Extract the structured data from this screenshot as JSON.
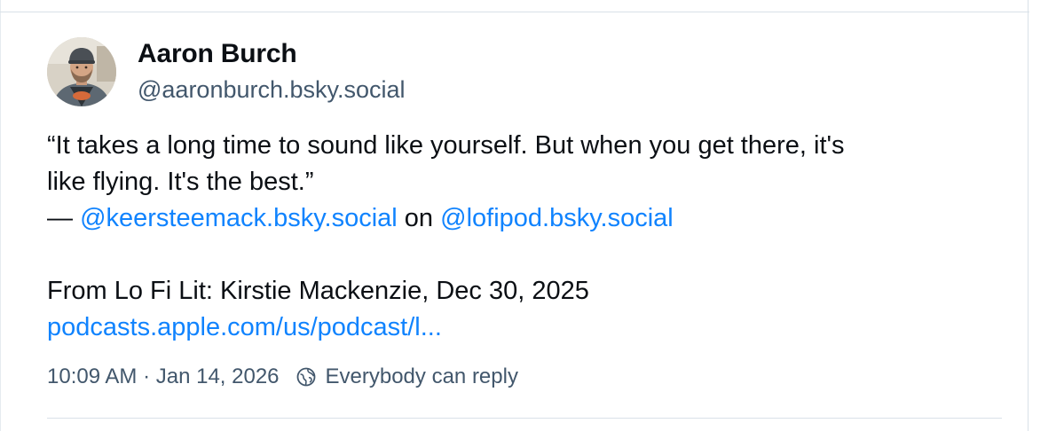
{
  "post": {
    "author": {
      "display_name": "Aaron Burch",
      "handle": "@aaronburch.bsky.social"
    },
    "text": {
      "quote_line_1": "“It takes a long time to sound like yourself. But when you get there, it's",
      "quote_line_2": "like flying. It's the best.”",
      "attribution_dash": "— ",
      "mention_1": "@keersteemack.bsky.social",
      "attribution_on": " on ",
      "mention_2": "@lofipod.bsky.social",
      "from_line": "From Lo Fi Lit: Kirstie Mackenzie, Dec 30, 2025",
      "link": "podcasts.apple.com/us/podcast/l..."
    },
    "meta": {
      "timestamp": "10:09 AM · Jan 14, 2026",
      "reply_setting": "Everybody can reply",
      "reply_icon": "globe-icon"
    }
  },
  "colors": {
    "link": "#1083fe",
    "muted": "#42576c",
    "text": "#0b0f14",
    "divider": "#d9e1e8"
  }
}
